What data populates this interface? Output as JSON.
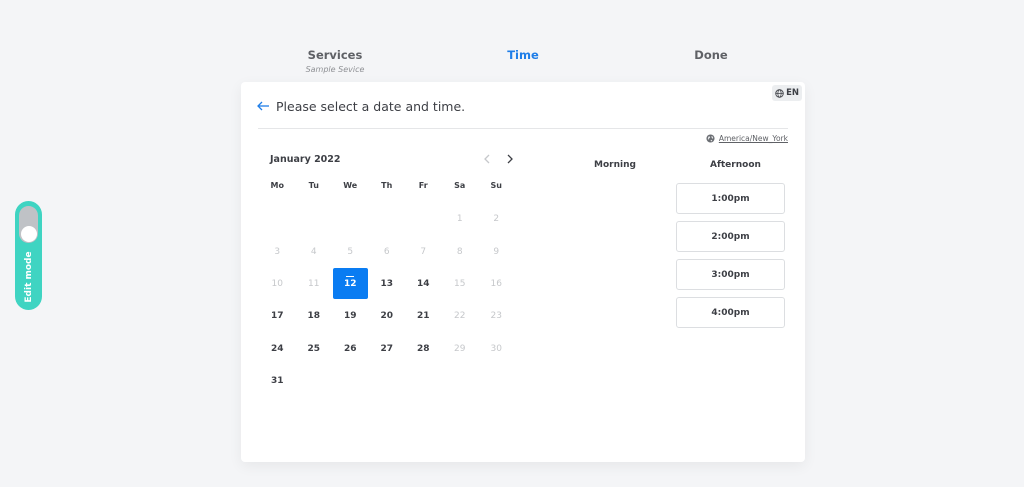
{
  "steps": {
    "services": {
      "label": "Services",
      "sub": "Sample Sevice"
    },
    "time": {
      "label": "Time"
    },
    "done": {
      "label": "Done"
    }
  },
  "header": {
    "heading": "Please select a date and time.",
    "language": "EN",
    "timezone": "America/New_York"
  },
  "calendar": {
    "month": "January 2022",
    "weekdays": [
      "Mo",
      "Tu",
      "We",
      "Th",
      "Fr",
      "Sa",
      "Su"
    ],
    "weeks": [
      [
        {
          "d": "",
          "s": "empty"
        },
        {
          "d": "",
          "s": "empty"
        },
        {
          "d": "",
          "s": "empty"
        },
        {
          "d": "",
          "s": "empty"
        },
        {
          "d": "",
          "s": "empty"
        },
        {
          "d": "1",
          "s": "disabled"
        },
        {
          "d": "2",
          "s": "disabled"
        }
      ],
      [
        {
          "d": "3",
          "s": "disabled"
        },
        {
          "d": "4",
          "s": "disabled"
        },
        {
          "d": "5",
          "s": "disabled"
        },
        {
          "d": "6",
          "s": "disabled"
        },
        {
          "d": "7",
          "s": "disabled"
        },
        {
          "d": "8",
          "s": "disabled"
        },
        {
          "d": "9",
          "s": "disabled"
        }
      ],
      [
        {
          "d": "10",
          "s": "disabled"
        },
        {
          "d": "11",
          "s": "disabled"
        },
        {
          "d": "12",
          "s": "selected"
        },
        {
          "d": "13",
          "s": "available"
        },
        {
          "d": "14",
          "s": "available"
        },
        {
          "d": "15",
          "s": "disabled"
        },
        {
          "d": "16",
          "s": "disabled"
        }
      ],
      [
        {
          "d": "17",
          "s": "available"
        },
        {
          "d": "18",
          "s": "available"
        },
        {
          "d": "19",
          "s": "available"
        },
        {
          "d": "20",
          "s": "available"
        },
        {
          "d": "21",
          "s": "available"
        },
        {
          "d": "22",
          "s": "disabled"
        },
        {
          "d": "23",
          "s": "disabled"
        }
      ],
      [
        {
          "d": "24",
          "s": "available"
        },
        {
          "d": "25",
          "s": "available"
        },
        {
          "d": "26",
          "s": "available"
        },
        {
          "d": "27",
          "s": "available"
        },
        {
          "d": "28",
          "s": "available"
        },
        {
          "d": "29",
          "s": "disabled"
        },
        {
          "d": "30",
          "s": "disabled"
        }
      ],
      [
        {
          "d": "31",
          "s": "available"
        }
      ]
    ]
  },
  "slots": {
    "morning_label": "Morning",
    "afternoon_label": "Afternoon",
    "afternoon": [
      "1:00pm",
      "2:00pm",
      "3:00pm",
      "4:00pm"
    ]
  },
  "edit_mode": {
    "label": "Edit mode",
    "enabled": false
  },
  "colors": {
    "accent": "#1f7ee8",
    "selected_day": "#0a7cf2",
    "toggle": "#3fd4c2"
  },
  "icons": {
    "back": "arrow-left-icon",
    "globe": "globe-icon",
    "prev": "chevron-left-icon",
    "next": "chevron-right-icon"
  }
}
